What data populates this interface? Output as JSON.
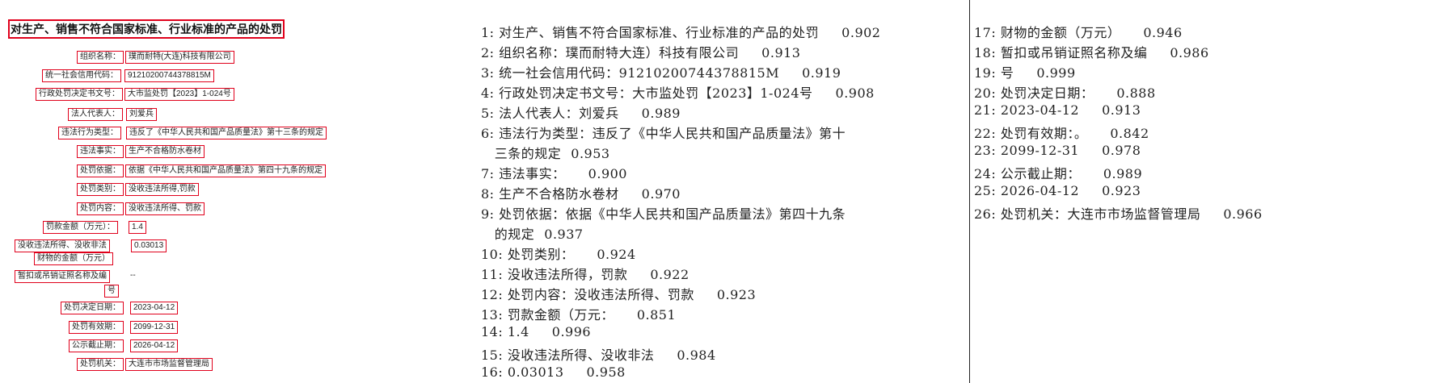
{
  "left": {
    "title": "对生产、销售不符合国家标准、行业标准的产品的处罚",
    "rows": [
      {
        "label": "组织名称：",
        "value": "璞而耐特(大连)科技有限公司"
      },
      {
        "label": "统一社会信用代码：",
        "value": "91210200744378815M"
      },
      {
        "label": "行政处罚决定书文号：",
        "value": "大市监处罚【2023】1-024号"
      },
      {
        "label": "法人代表人：",
        "value": "刘爱兵"
      },
      {
        "label": "违法行为类型：",
        "value": "违反了《中华人民共和国产品质量法》第十三条的规定"
      },
      {
        "label": "违法事实：",
        "value": "生产不合格防水卷材"
      },
      {
        "label": "处罚依据：",
        "value": "依据《中华人民共和国产品质量法》第四十九条的规定"
      },
      {
        "label": "处罚类别：",
        "value": "没收违法所得,罚款"
      },
      {
        "label": "处罚内容：",
        "value": "没收违法所得、罚款"
      },
      {
        "label": "罚款金额（万元）：",
        "value": "1.4"
      },
      {
        "label": "没收违法所得、没收非法",
        "value": "0.03013"
      },
      {
        "label": "财物的金额（万元）",
        "value": ""
      },
      {
        "label": "暂扣或吊销证照名称及编",
        "value": "--"
      },
      {
        "label": "号",
        "value": ""
      },
      {
        "label": "处罚决定日期：",
        "value": "2023-04-12"
      },
      {
        "label": "处罚有效期：",
        "value": "2099-12-31"
      },
      {
        "label": "公示截止期：",
        "value": "2026-04-12"
      },
      {
        "label": "处罚机关：",
        "value": "大连市市场监督管理局"
      }
    ]
  },
  "results_mid": [
    {
      "text": "1: 对生产、销售不符合国家标准、行业标准的产品的处罚",
      "score": "0.902"
    },
    {
      "text": "2: 组织名称：璞而耐特大连）科技有限公司",
      "score": "0.913"
    },
    {
      "text": "3: 统一社会信用代码：91210200744378815M",
      "score": "0.919"
    },
    {
      "text": "4: 行政处罚决定书文号：大市监处罚【2023】1-024号",
      "score": "0.908"
    },
    {
      "text": "5: 法人代表人：刘爱兵",
      "score": "0.989"
    },
    {
      "text": "6: 违法行为类型：违反了《中华人民共和国产品质量法》第十",
      "score": ""
    },
    {
      "text": "   三条的规定",
      "score": "0.953"
    },
    {
      "text": "7: 违法事实：",
      "score": "0.900"
    },
    {
      "text": "8: 生产不合格防水卷材",
      "score": "0.970"
    },
    {
      "text": "9: 处罚依据：依据《中华人民共和国产品质量法》第四十九条",
      "score": ""
    },
    {
      "text": "   的规定",
      "score": "0.937"
    },
    {
      "text": "10: 处罚类别：",
      "score": "0.924"
    },
    {
      "text": "11: 没收违法所得，罚款",
      "score": "0.922"
    },
    {
      "text": "12: 处罚内容：没收违法所得、罚款",
      "score": "0.923"
    },
    {
      "text": "13: 罚款金额（万元：",
      "score": "0.851"
    },
    {
      "text": "14: 1.4",
      "score": "0.996"
    },
    {
      "text": "15: 没收违法所得、没收非法",
      "score": "0.984"
    },
    {
      "text": "16: 0.03013",
      "score": "0.958"
    }
  ],
  "results_right": [
    {
      "text": "17: 财物的金额（万元）",
      "score": "0.946"
    },
    {
      "text": "18: 暂扣或吊销证照名称及编",
      "score": "0.986"
    },
    {
      "text": "19: 号",
      "score": "0.999"
    },
    {
      "text": "20: 处罚决定日期：",
      "score": "0.888"
    },
    {
      "text": "21: 2023-04-12",
      "score": "0.913"
    },
    {
      "text": "22: 处罚有效期：。",
      "score": "0.842"
    },
    {
      "text": "23: 2099-12-31",
      "score": "0.978"
    },
    {
      "text": "24: 公示截止期：",
      "score": "0.989"
    },
    {
      "text": "25: 2026-04-12",
      "score": "0.923"
    },
    {
      "text": "26: 处罚机关：大连市市场监督管理局",
      "score": "0.966"
    }
  ]
}
